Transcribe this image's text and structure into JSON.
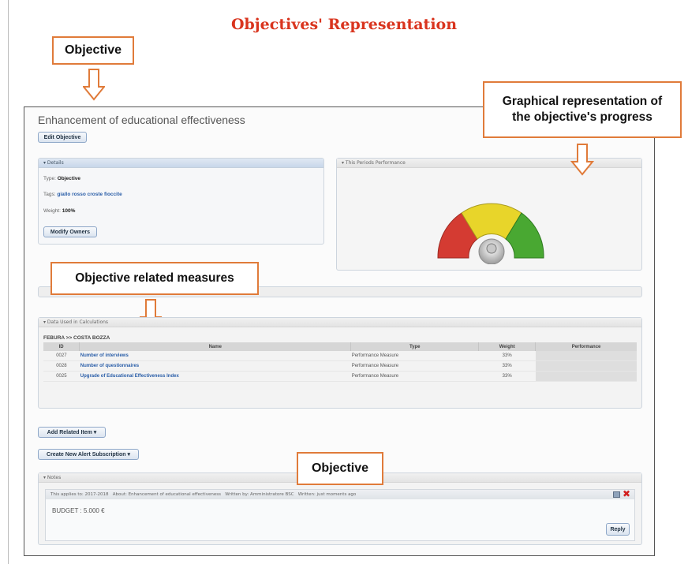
{
  "page_title": "Objectives' Representation",
  "callouts": {
    "objective_top": "Objective",
    "graphical": "Graphical representation of the objective's progress",
    "measures": "Objective related measures",
    "objective_bottom": "Objective"
  },
  "objective": {
    "title": "Enhancement of educational effectiveness",
    "edit_button": "Edit Objective"
  },
  "details": {
    "header": "▾ Details",
    "type_label": "Type:",
    "type_value": "Objective",
    "tags_label": "Tags:",
    "tag1": "giallo rosso",
    "tag2": "croste fioccite",
    "weight_label": "Weight:",
    "weight_value": "100%",
    "modify_button": "Modify Owners"
  },
  "performance": {
    "header": "▾ This Periods Performance",
    "gauge_colors": [
      "#d43b32",
      "#e8d52a",
      "#49a832"
    ]
  },
  "data_used": {
    "header": "▾ Data Used in Calculations",
    "breadcrumb": "FEBURA >> COSTA BOZZA",
    "columns": [
      "ID",
      "Name",
      "Type",
      "Weight",
      "Performance"
    ],
    "rows": [
      {
        "id": "0027",
        "name": "Number of interviews",
        "type": "Performance Measure",
        "weight": "33%"
      },
      {
        "id": "0028",
        "name": "Number of questionnaires",
        "type": "Performance Measure",
        "weight": "33%"
      },
      {
        "id": "0025",
        "name": "Upgrade of Educational Effectiveness Index",
        "type": "Performance Measure",
        "weight": "33%"
      }
    ]
  },
  "buttons": {
    "add_related": "Add Related Item ▾",
    "create_alert": "Create New Alert Subscription ▾",
    "reply": "Reply"
  },
  "notes": {
    "header": "▾ Notes",
    "meta_period": "This applies to: 2017-2018",
    "meta_about": "About: Enhancement of educational effectiveness",
    "meta_author": "Written by: Amministratore BSC",
    "meta_when": "Written: just moments ago",
    "body": "BUDGET : 5.000 €"
  }
}
